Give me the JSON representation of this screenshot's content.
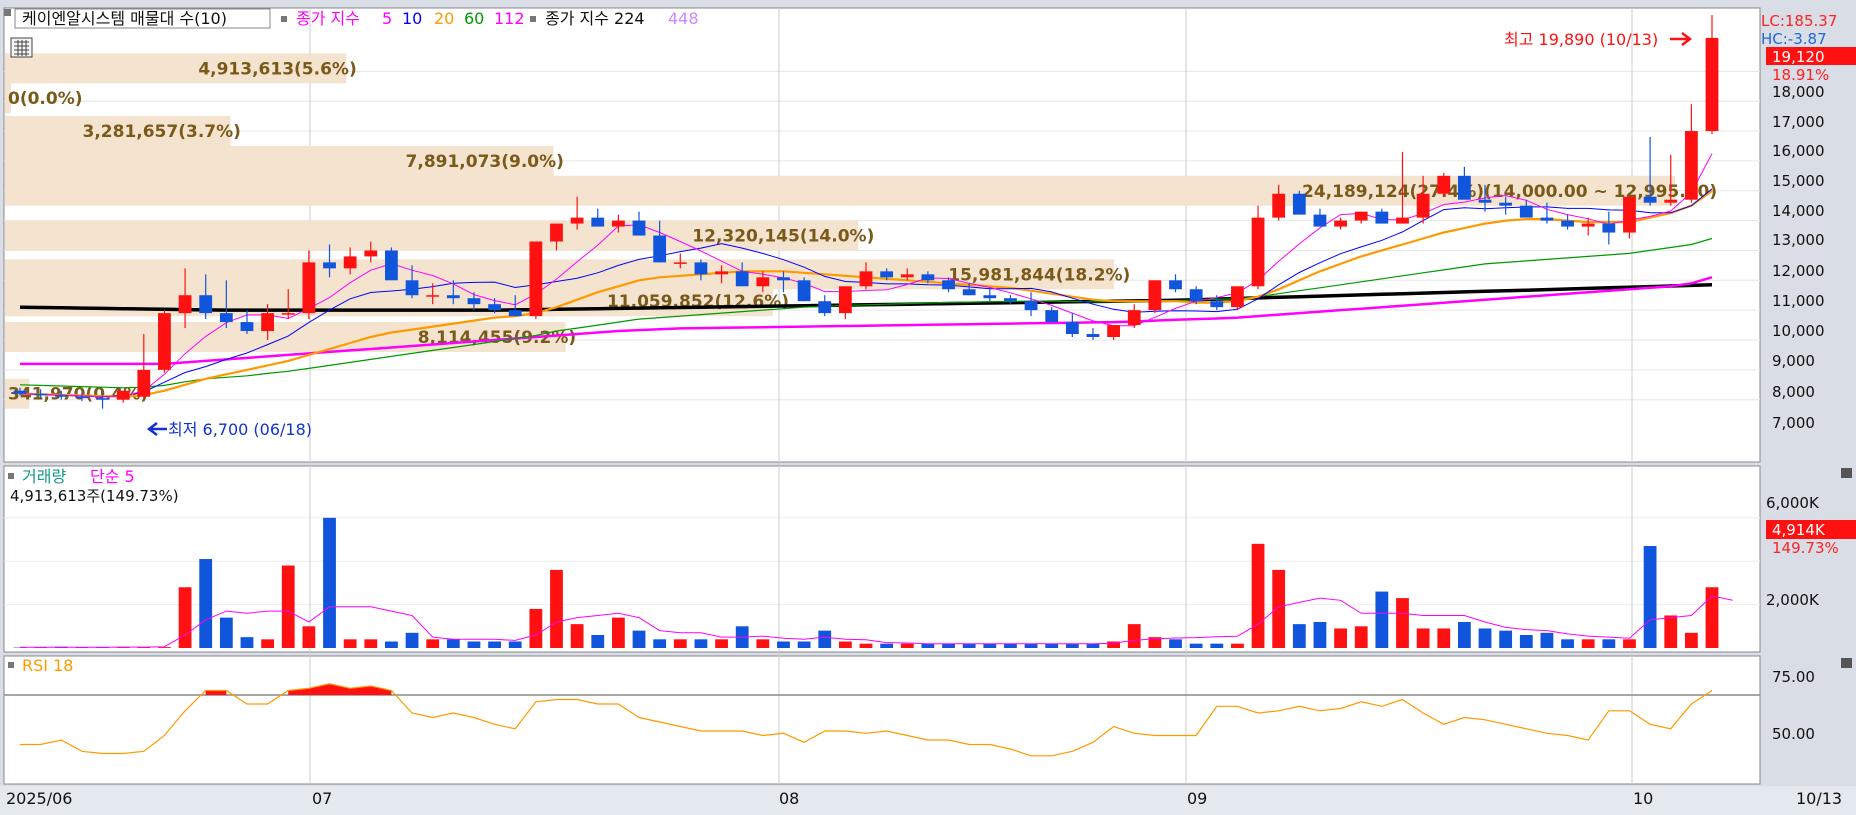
{
  "price_header": {
    "title": "케이엔알시스템 매물대 수(10)",
    "ma_label": "종가 지수",
    "ma_periods": [
      {
        "text": "5",
        "color": "#ff00ff"
      },
      {
        "text": "10",
        "color": "#0000ff"
      },
      {
        "text": "20",
        "color": "#ff9900"
      },
      {
        "text": "60",
        "color": "#009900"
      },
      {
        "text": "112",
        "color": "#ff00ff"
      }
    ],
    "ma2_label": "종가 지수 224",
    "ma2_extra": "448"
  },
  "top_right": {
    "lc": "LC:185.37",
    "hc": "HC:-3.87",
    "current_price": "19,120",
    "change_pct": "18.91%"
  },
  "annotations": {
    "high": "최고 19,890 (10/13)",
    "low": "최저 6,700 (06/18)"
  },
  "volume_header": {
    "label": "거래량",
    "ma_label": "단순 5",
    "value": "4,913,613주(149.73%)",
    "last_label": "4,914K",
    "last_pct": "149.73%"
  },
  "rsi_header": {
    "label": "RSI 18"
  },
  "axis": {
    "dates": [
      "2025/06",
      "07",
      "08",
      "09",
      "10",
      "10/13"
    ],
    "price_ticks": [
      "18,000",
      "17,000",
      "16,000",
      "15,000",
      "14,000",
      "13,000",
      "12,000",
      "11,000",
      "10,000",
      "9,000",
      "8,000",
      "7,000"
    ],
    "volume_ticks": [
      "6,000K",
      "2,000K"
    ],
    "rsi_ticks": [
      "75.00",
      "50.00"
    ]
  },
  "colors": {
    "up": "#ff1111",
    "down": "#1155dd",
    "ma5": "#ff00ff",
    "ma10": "#0000ff",
    "ma20": "#ff9900",
    "ma60": "#009900",
    "ma112": "#ff00ff",
    "ma224": "#000000",
    "vp_fill": "#f3e3cc",
    "vp_text": "#7a5a1a",
    "rsi": "#ff9900"
  },
  "chart_data": {
    "type": "candlestick",
    "x": [
      "06/11",
      "06/12",
      "06/13",
      "06/16",
      "06/17",
      "06/18",
      "06/19",
      "06/20",
      "06/23",
      "06/24",
      "06/25",
      "06/26",
      "06/27",
      "06/30",
      "07/01",
      "07/02",
      "07/03",
      "07/04",
      "07/07",
      "07/08",
      "07/09",
      "07/10",
      "07/11",
      "07/14",
      "07/15",
      "07/16",
      "07/17",
      "07/18",
      "07/21",
      "07/22",
      "07/23",
      "07/24",
      "07/25",
      "07/28",
      "07/29",
      "07/30",
      "07/31",
      "08/01",
      "08/04",
      "08/05",
      "08/06",
      "08/07",
      "08/08",
      "08/11",
      "08/12",
      "08/13",
      "08/14",
      "08/18",
      "08/19",
      "08/20",
      "08/21",
      "08/22",
      "08/25",
      "08/26",
      "08/27",
      "08/28",
      "08/29",
      "09/01",
      "09/02",
      "09/03",
      "09/04",
      "09/05",
      "09/08",
      "09/09",
      "09/10",
      "09/11",
      "09/12",
      "09/15",
      "09/16",
      "09/17",
      "09/18",
      "09/19",
      "09/22",
      "09/23",
      "09/24",
      "09/25",
      "09/26",
      "09/29",
      "09/30",
      "10/01",
      "10/02",
      "10/10",
      "10/13"
    ],
    "open": [
      7300,
      7200,
      7150,
      7100,
      7050,
      7000,
      7100,
      8000,
      9900,
      10500,
      9900,
      9600,
      9300,
      9900,
      9900,
      11600,
      11400,
      11800,
      12000,
      11000,
      10500,
      10500,
      10400,
      10200,
      10000,
      9800,
      12300,
      12900,
      13100,
      12800,
      13000,
      12500,
      11600,
      11600,
      11200,
      11300,
      10800,
      11100,
      11000,
      10300,
      9900,
      10800,
      11300,
      11100,
      11200,
      11000,
      10700,
      10500,
      10400,
      10300,
      10000,
      9600,
      9200,
      9100,
      9500,
      10000,
      11000,
      10700,
      10300,
      10100,
      10800,
      13100,
      13900,
      13200,
      12800,
      13000,
      13300,
      12900,
      13100,
      13900,
      14500,
      13700,
      13600,
      13500,
      13100,
      13000,
      12800,
      12900,
      12600,
      13800,
      13600,
      13700,
      16000
    ],
    "high": [
      7400,
      7350,
      7300,
      7200,
      7150,
      7300,
      9200,
      10000,
      11400,
      11200,
      11000,
      10000,
      10200,
      10700,
      12000,
      12200,
      12100,
      12300,
      12100,
      11500,
      10900,
      11000,
      10600,
      10400,
      10500,
      10000,
      12900,
      13800,
      13400,
      13200,
      13300,
      13000,
      11900,
      11700,
      11500,
      11600,
      11300,
      11300,
      11100,
      10500,
      10100,
      11600,
      11400,
      11400,
      11300,
      11100,
      10900,
      10700,
      10500,
      10600,
      10100,
      9900,
      9400,
      9200,
      10200,
      11000,
      11200,
      10800,
      10500,
      10300,
      13500,
      14200,
      14000,
      13400,
      13100,
      13300,
      13400,
      15300,
      14500,
      14600,
      14800,
      14200,
      13800,
      13700,
      13600,
      13200,
      13100,
      13300,
      13300,
      15800,
      15200,
      16900,
      19890
    ],
    "low": [
      7150,
      7050,
      7000,
      6950,
      6700,
      6900,
      7050,
      7900,
      9400,
      9700,
      9400,
      9200,
      9000,
      9700,
      9700,
      11100,
      11200,
      11600,
      11200,
      10400,
      10200,
      10200,
      10000,
      9900,
      9800,
      9700,
      12000,
      12700,
      12800,
      12600,
      12800,
      11600,
      11400,
      11000,
      10900,
      11000,
      10600,
      10600,
      10300,
      9800,
      9700,
      10700,
      11000,
      11000,
      10900,
      10600,
      10500,
      10300,
      10200,
      9800,
      9600,
      9100,
      9000,
      9000,
      9400,
      9900,
      10600,
      10200,
      10000,
      10000,
      10700,
      13000,
      13500,
      12900,
      12700,
      12900,
      13000,
      12900,
      12900,
      13800,
      14000,
      13300,
      13200,
      13300,
      12900,
      12700,
      12500,
      12200,
      12400,
      13500,
      13500,
      13600,
      15900
    ],
    "close": [
      7200,
      7150,
      7100,
      7050,
      7000,
      7300,
      8000,
      9900,
      10500,
      9900,
      9600,
      9300,
      9900,
      9900,
      11600,
      11400,
      11800,
      12000,
      11000,
      10500,
      10500,
      10400,
      10200,
      10000,
      9800,
      12300,
      12900,
      13100,
      12800,
      13000,
      12500,
      11600,
      11600,
      11200,
      11300,
      10800,
      11100,
      11000,
      10300,
      9900,
      10800,
      11300,
      11100,
      11200,
      11000,
      10700,
      10500,
      10400,
      10300,
      10000,
      9600,
      9200,
      9100,
      9500,
      10000,
      11000,
      10700,
      10300,
      10100,
      10800,
      13100,
      13900,
      13200,
      12800,
      13000,
      13300,
      12900,
      13100,
      13900,
      14500,
      13700,
      13600,
      13500,
      13100,
      13000,
      12800,
      12900,
      12600,
      13800,
      13600,
      13700,
      16000,
      19120
    ],
    "volume": [
      20,
      20,
      60,
      40,
      30,
      40,
      30,
      40,
      2800,
      4100,
      1400,
      500,
      400,
      3800,
      1000,
      6000,
      400,
      400,
      300,
      700,
      400,
      400,
      300,
      300,
      300,
      1800,
      3600,
      1100,
      600,
      1400,
      800,
      400,
      400,
      400,
      400,
      1000,
      400,
      300,
      300,
      800,
      300,
      200,
      200,
      200,
      200,
      200,
      200,
      200,
      200,
      200,
      200,
      200,
      200,
      300,
      1100,
      500,
      400,
      200,
      200,
      200,
      4800,
      3600,
      1100,
      1200,
      900,
      1000,
      2600,
      2300,
      900,
      900,
      1200,
      900,
      800,
      600,
      700,
      400,
      400,
      400,
      400,
      4700,
      1500,
      700,
      2800,
      4914
    ],
    "volume_ma5": [
      30,
      30,
      30,
      35,
      35,
      40,
      40,
      60,
      600,
      1300,
      1700,
      1600,
      1700,
      1700,
      1200,
      1900,
      1900,
      1900,
      1700,
      1500,
      500,
      400,
      400,
      400,
      350,
      600,
      1200,
      1400,
      1500,
      1600,
      1400,
      800,
      700,
      700,
      500,
      500,
      550,
      450,
      400,
      500,
      400,
      380,
      250,
      230,
      200,
      200,
      200,
      200,
      200,
      200,
      200,
      200,
      200,
      220,
      360,
      420,
      460,
      480,
      520,
      540,
      1100,
      1900,
      2100,
      2300,
      2200,
      1600,
      1600,
      1600,
      1500,
      1500,
      1500,
      1200,
      950,
      850,
      800,
      650,
      550,
      500,
      450,
      1300,
      1400,
      1500,
      2400,
      2200
    ],
    "rsi": [
      48,
      48,
      50,
      45,
      44,
      44,
      45,
      52,
      63,
      72,
      72,
      66,
      66,
      72,
      73,
      75,
      73,
      74,
      72,
      62,
      60,
      62,
      60,
      57,
      55,
      67,
      68,
      68,
      66,
      66,
      60,
      58,
      56,
      54,
      54,
      54,
      52,
      53,
      49,
      54,
      54,
      53,
      54,
      52,
      50,
      50,
      48,
      48,
      46,
      43,
      43,
      45,
      49,
      56,
      53,
      52,
      52,
      52,
      65,
      65,
      62,
      63,
      65,
      63,
      64,
      67,
      65,
      68,
      62,
      57,
      60,
      59,
      57,
      55,
      53,
      52,
      50,
      63,
      63,
      57,
      55,
      66,
      72
    ],
    "ma224": [
      10100,
      10090,
      10080,
      10070,
      10060,
      10050,
      10040,
      10030,
      10020,
      10010,
      10000,
      10000,
      10000,
      10000,
      10000,
      10000,
      10000,
      10000,
      10000,
      10000,
      10000,
      10000,
      10000,
      10000,
      10010,
      10020,
      10030,
      10040,
      10050,
      10060,
      10070,
      10080,
      10090,
      10100,
      10110,
      10120,
      10130,
      10140,
      10150,
      10160,
      10170,
      10180,
      10190,
      10200,
      10210,
      10220,
      10230,
      10240,
      10250,
      10260,
      10270,
      10280,
      10290,
      10300,
      10310,
      10320,
      10330,
      10350,
      10370,
      10390,
      10410,
      10430,
      10450,
      10470,
      10490,
      10510,
      10530,
      10550,
      10570,
      10590,
      10610,
      10630,
      10650,
      10670,
      10690,
      10710,
      10730,
      10750,
      10770,
      10790,
      10810,
      10830,
      10850
    ],
    "ma112": [
      8200,
      8200,
      8200,
      8200,
      8200,
      8200,
      8200,
      8200,
      8250,
      8300,
      8350,
      8400,
      8450,
      8500,
      8550,
      8600,
      8650,
      8700,
      8750,
      8800,
      8850,
      8900,
      8950,
      9000,
      9050,
      9100,
      9150,
      9200,
      9250,
      9300,
      9330,
      9360,
      9390,
      9400,
      9410,
      9420,
      9430,
      9440,
      9450,
      9460,
      9470,
      9480,
      9490,
      9500,
      9510,
      9520,
      9530,
      9540,
      9550,
      9560,
      9570,
      9580,
      9590,
      9600,
      9620,
      9650,
      9680,
      9700,
      9720,
      9750,
      9800,
      9850,
      9900,
      9950,
      10000,
      10050,
      10100,
      10150,
      10200,
      10250,
      10300,
      10350,
      10400,
      10450,
      10500,
      10550,
      10600,
      10650,
      10700,
      10750,
      10800,
      10900,
      11100
    ],
    "ma60": [
      7500,
      7480,
      7460,
      7440,
      7420,
      7400,
      7420,
      7480,
      7600,
      7700,
      7750,
      7800,
      7880,
      7950,
      8050,
      8150,
      8250,
      8350,
      8450,
      8550,
      8650,
      8750,
      8850,
      8950,
      9050,
      9150,
      9300,
      9400,
      9500,
      9600,
      9700,
      9750,
      9800,
      9850,
      9900,
      9950,
      10000,
      10050,
      10100,
      10130,
      10160,
      10180,
      10200,
      10220,
      10240,
      10260,
      10270,
      10280,
      10290,
      10300,
      10300,
      10290,
      10280,
      10280,
      10280,
      10300,
      10320,
      10340,
      10360,
      10380,
      10450,
      10550,
      10650,
      10750,
      10850,
      10950,
      11050,
      11150,
      11250,
      11350,
      11450,
      11550,
      11600,
      11650,
      11700,
      11750,
      11800,
      11850,
      11900,
      12000,
      12100,
      12200,
      12400
    ],
    "ma20": [
      7200,
      7180,
      7160,
      7140,
      7120,
      7100,
      7150,
      7300,
      7500,
      7700,
      7850,
      8000,
      8150,
      8300,
      8500,
      8700,
      8900,
      9100,
      9250,
      9350,
      9450,
      9550,
      9650,
      9750,
      9800,
      9900,
      10100,
      10350,
      10600,
      10800,
      11000,
      11100,
      11150,
      11200,
      11250,
      11300,
      11300,
      11300,
      11250,
      11200,
      11150,
      11100,
      11050,
      11000,
      10950,
      10900,
      10850,
      10800,
      10750,
      10650,
      10550,
      10450,
      10350,
      10300,
      10300,
      10300,
      10300,
      10250,
      10250,
      10300,
      10450,
      10700,
      11000,
      11300,
      11550,
      11800,
      12000,
      12200,
      12400,
      12600,
      12750,
      12900,
      13000,
      13050,
      13050,
      13000,
      12950,
      12950,
      12950,
      13100,
      13250,
      13500,
      14000
    ],
    "volume_profile": [
      {
        "label": "4,913,613(5.6%)",
        "value_pct": 5.6
      },
      {
        "label": "0(0.0%)",
        "value_pct": 0.0
      },
      {
        "label": "3,281,657(3.7%)",
        "value_pct": 3.7
      },
      {
        "label": "7,891,073(9.0%)",
        "value_pct": 9.0
      },
      {
        "label": "24,189,124(27.4%)(14,000.00 ~ 12,995.00)",
        "value_pct": 27.4
      },
      {
        "label": "12,320,145(14.0%)",
        "value_pct": 14.0
      },
      {
        "label": "15,981,844(18.2%)",
        "value_pct": 18.2
      },
      {
        "label": "11,059,852(12.6%)",
        "value_pct": 12.6
      },
      {
        "label": "8,114,455(9.2%)",
        "value_pct": 9.2
      },
      {
        "label": "341,970(0.4%)",
        "value_pct": 0.4
      }
    ]
  }
}
